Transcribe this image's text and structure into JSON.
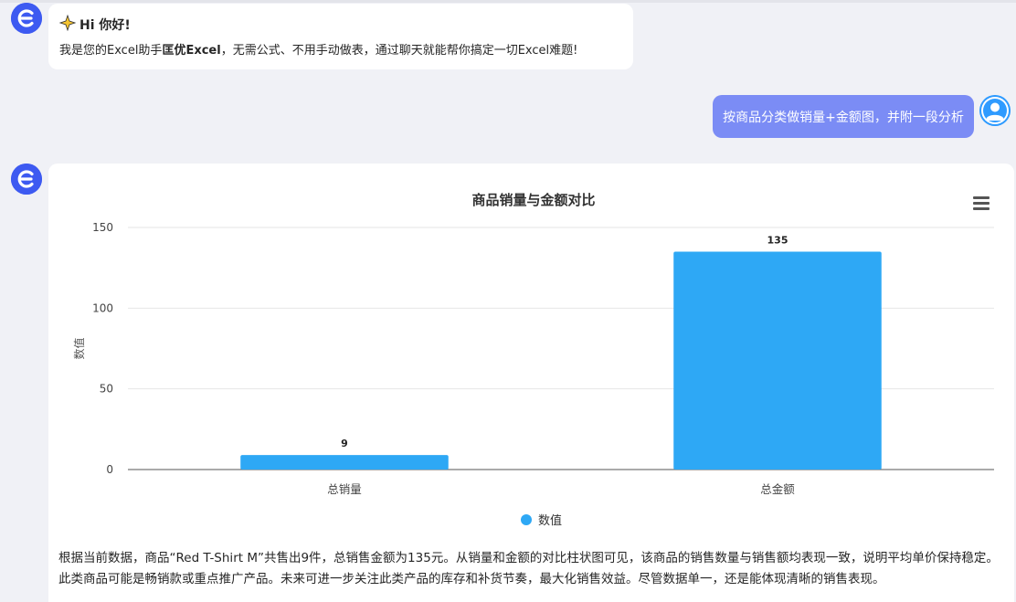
{
  "greeting": {
    "title": "Hi 你好!",
    "body_prefix": "我是您的Excel助手",
    "brand": "匡优Excel",
    "body_suffix": "，无需公式、不用手动做表，通过聊天就能帮你搞定一切Excel难题!"
  },
  "user_message": "按商品分类做销量+金额图，并附一段分析",
  "chart_data": {
    "type": "bar",
    "title": "商品销量与金额对比",
    "categories": [
      "总销量",
      "总金额"
    ],
    "series": [
      {
        "name": "数值",
        "values": [
          9,
          135
        ]
      }
    ],
    "ylabel": "数值",
    "xlabel": "",
    "ylim": [
      0,
      150
    ],
    "yticks": [
      0,
      50,
      100,
      150
    ],
    "grid": true,
    "legend": "bottom-center",
    "bar_color": "#2ea8f5"
  },
  "analysis": "根据当前数据，商品“Red T-Shirt M”共售出9件，总销售金额为135元。从销量和金额的对比柱状图可见，该商品的销售数量与销售额均表现一致，说明平均单价保持稳定。此类商品可能是畅销款或重点推广产品。未来可进一步关注此类产品的库存和补货节奏，最大化销售效益。尽管数据单一，还是能体现清晰的销售表现。",
  "icons": {
    "bot_avatar": "brand-e-icon",
    "user_avatar": "user-icon",
    "chart_menu": "hamburger-menu-icon",
    "greeting": "sparkle-icon"
  },
  "colors": {
    "brand": "#3d5af1",
    "user_bubble": "#7b8cf5",
    "bar": "#2ea8f5"
  }
}
